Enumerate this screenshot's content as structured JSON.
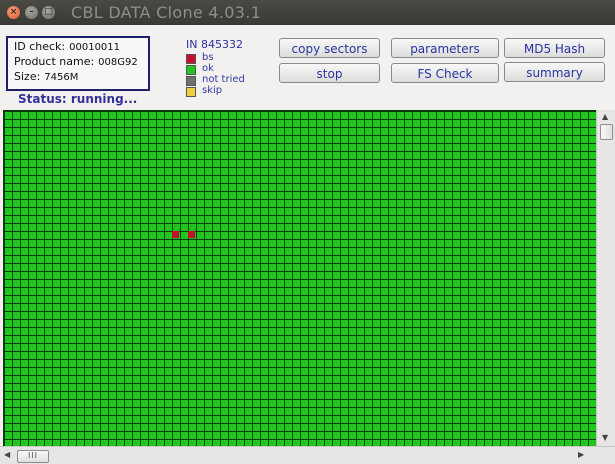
{
  "window": {
    "title": "CBL DATA Clone 4.03.1"
  },
  "info": {
    "id_label": "ID check:",
    "id_value": "00010011",
    "product_label": "Product name:",
    "product_value": "008G92",
    "size_label": "Size:",
    "size_value": "7456M"
  },
  "legend": {
    "in_value": "IN 845332",
    "items": [
      {
        "label": "bs",
        "color": "#c8102a"
      },
      {
        "label": "ok",
        "color": "#1ec61e"
      },
      {
        "label": "not tried",
        "color": "#707070"
      },
      {
        "label": "skip",
        "color": "#f0d040"
      }
    ]
  },
  "buttons": {
    "copy_sectors": "copy sectors",
    "parameters": "parameters",
    "md5_hash": "MD5 Hash",
    "stop": "stop",
    "fs_check": "FS Check",
    "summary": "summary"
  },
  "status": "Status: running...",
  "sector_map": {
    "bad_sectors": [
      {
        "col": 21,
        "row": 15
      },
      {
        "col": 23,
        "row": 15
      }
    ]
  },
  "scrollbar": {
    "h_thumb_glyph": "III",
    "up_arrow": "▲",
    "down_arrow": "▼",
    "left_arrow": "◀",
    "right_arrow": "▶"
  },
  "colors": {
    "ok": "#1ec61e",
    "bad": "#c8102a",
    "accent": "#2a33a0",
    "box_border": "#20206a"
  }
}
